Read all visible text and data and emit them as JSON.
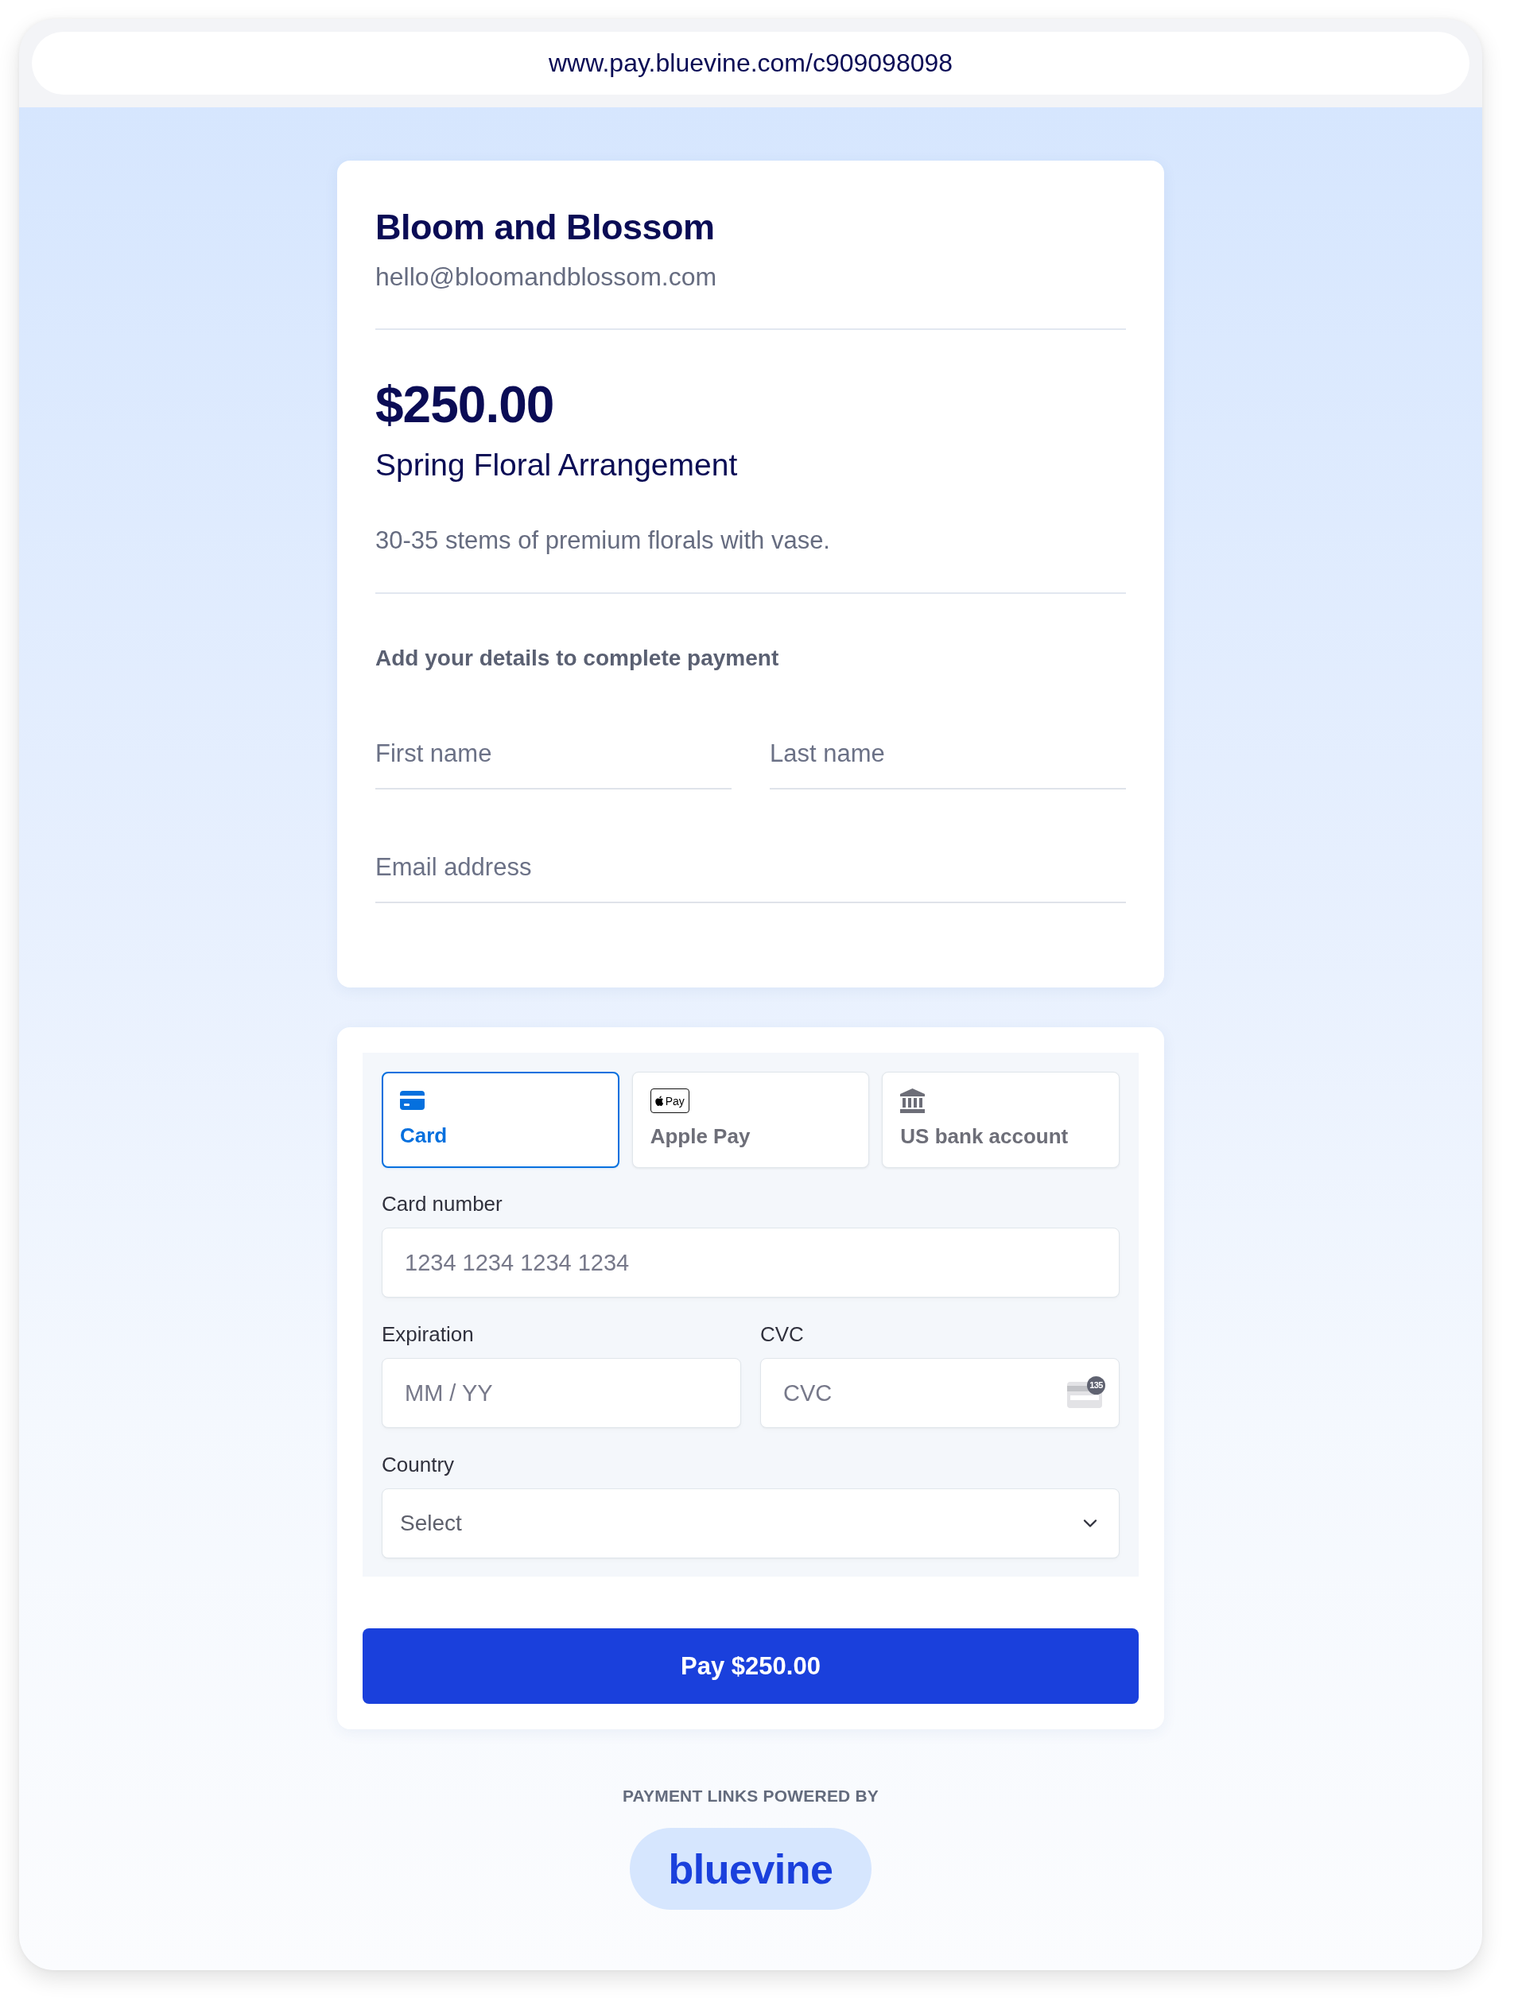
{
  "browser": {
    "url": "www.pay.bluevine.com/c909098098"
  },
  "merchant": {
    "name": "Bloom and Blossom",
    "email": "hello@bloomandblossom.com"
  },
  "item": {
    "price": "$250.00",
    "title": "Spring Floral Arrangement",
    "description": "30-35 stems of premium florals with vase."
  },
  "details": {
    "heading": "Add your details to complete payment",
    "rows": [
      [
        {
          "placeholder": "First name"
        },
        {
          "placeholder": "Last name"
        }
      ],
      [
        {
          "placeholder": "Email address"
        }
      ]
    ]
  },
  "payment": {
    "methods": [
      {
        "kind": "card",
        "label": "Card",
        "selected": true
      },
      {
        "kind": "wallet",
        "label": "Apple Pay",
        "badge": "Pay",
        "selected": false
      },
      {
        "kind": "bank",
        "label": "US bank account",
        "selected": false
      }
    ],
    "rows": [
      [
        {
          "kind": "text",
          "label": "Card number",
          "placeholder": "1234 1234 1234 1234"
        }
      ],
      [
        {
          "kind": "text",
          "label": "Expiration",
          "placeholder": "MM / YY"
        },
        {
          "kind": "cvc",
          "label": "CVC",
          "placeholder": "CVC",
          "badge": "135"
        }
      ],
      [
        {
          "kind": "select",
          "label": "Country",
          "placeholder": "Select"
        }
      ]
    ]
  },
  "pay_button": {
    "label": "Pay $250.00"
  },
  "footer": {
    "caption": "PAYMENT LINKS POWERED BY",
    "logo": "bluevine"
  }
}
